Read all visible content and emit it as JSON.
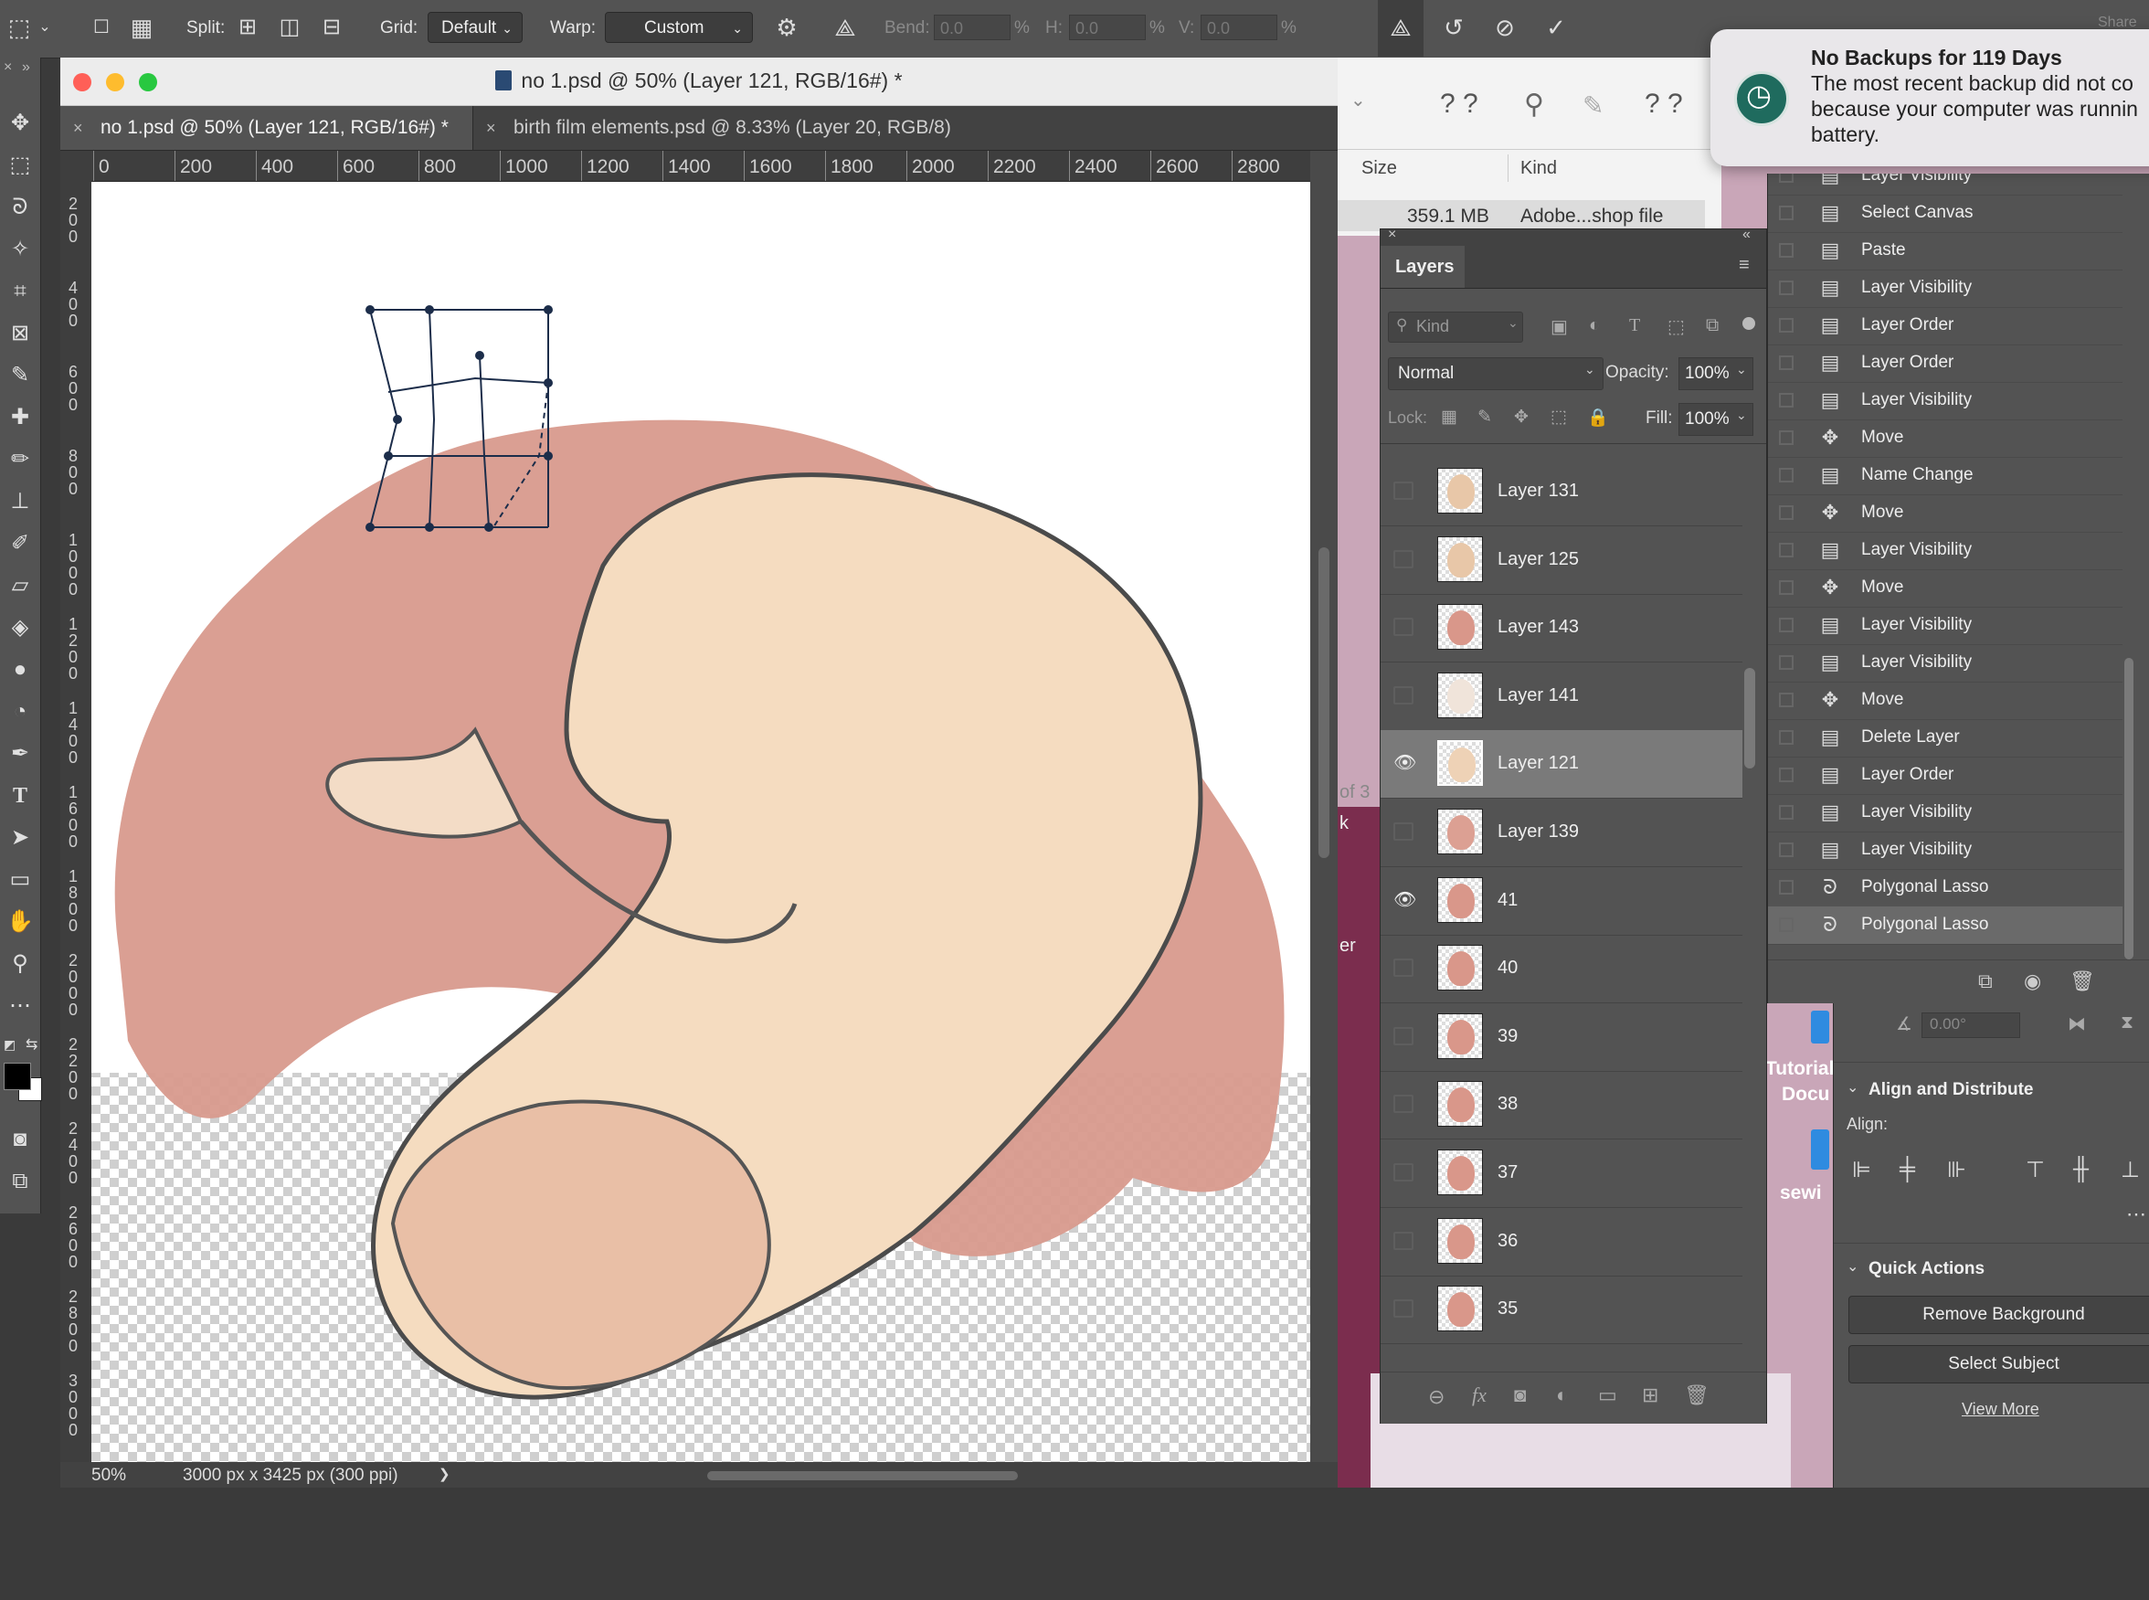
{
  "options_bar": {
    "split_label": "Split:",
    "grid_label": "Grid:",
    "grid_value": "Default",
    "warp_label": "Warp:",
    "warp_value": "Custom",
    "bend_label": "Bend:",
    "bend_value": "0.0",
    "h_label": "H:",
    "h_value": "0.0",
    "v_label": "V:",
    "v_value": "0.0",
    "percent": "%",
    "share_label": "Share"
  },
  "document": {
    "window_title": "no 1.psd @ 50% (Layer 121, RGB/16#) *",
    "tabs": [
      {
        "label": "no 1.psd @ 50% (Layer 121, RGB/16#) *",
        "active": true
      },
      {
        "label": "birth film elements.psd @ 8.33% (Layer 20, RGB/8)",
        "active": false
      }
    ],
    "ruler_h": [
      "0",
      "200",
      "400",
      "600",
      "800",
      "1000",
      "1200",
      "1400",
      "1600",
      "1800",
      "2000",
      "2200",
      "2400",
      "2600",
      "2800"
    ],
    "ruler_v": [
      "200",
      "400",
      "600",
      "800",
      "1000",
      "1200",
      "1400",
      "1600",
      "1800",
      "2000",
      "2200",
      "2400",
      "2600",
      "2800",
      "3000"
    ],
    "zoom": "50%",
    "doc_info": "3000 px x 3425 px (300 ppi)",
    "status_arrow": "❯"
  },
  "finder": {
    "col_size": "Size",
    "col_kind": "Kind",
    "file_size": "359.1 MB",
    "file_kind": "Adobe...shop file",
    "partial_of": "of 3",
    "partial_k": "k",
    "partial_er": "er",
    "partial_tutorial": "Tutorial",
    "partial_docu": "Docu",
    "partial_sewi": "sewi"
  },
  "layers_panel": {
    "tab_label": "Layers",
    "filter_placeholder": "Kind",
    "blend_mode": "Normal",
    "opacity_label": "Opacity:",
    "opacity_value": "100%",
    "lock_label": "Lock:",
    "fill_label": "Fill:",
    "fill_value": "100%",
    "layers": [
      {
        "name": "Layer 131",
        "visible": false,
        "selected": false
      },
      {
        "name": "Layer 125",
        "visible": false,
        "selected": false
      },
      {
        "name": "Layer 143",
        "visible": false,
        "selected": false
      },
      {
        "name": "Layer 141",
        "visible": false,
        "selected": false
      },
      {
        "name": "Layer 121",
        "visible": true,
        "selected": true
      },
      {
        "name": "Layer 139",
        "visible": false,
        "selected": false
      },
      {
        "name": "41",
        "visible": true,
        "selected": false
      },
      {
        "name": "40",
        "visible": false,
        "selected": false
      },
      {
        "name": "39",
        "visible": false,
        "selected": false
      },
      {
        "name": "38",
        "visible": false,
        "selected": false
      },
      {
        "name": "37",
        "visible": false,
        "selected": false
      },
      {
        "name": "36",
        "visible": false,
        "selected": false
      },
      {
        "name": "35",
        "visible": false,
        "selected": false
      }
    ]
  },
  "history_panel": {
    "items": [
      {
        "name": "Layer Visibility",
        "icon": "doc"
      },
      {
        "name": "Select Canvas",
        "icon": "doc"
      },
      {
        "name": "Paste",
        "icon": "doc"
      },
      {
        "name": "Layer Visibility",
        "icon": "doc"
      },
      {
        "name": "Layer Order",
        "icon": "doc"
      },
      {
        "name": "Layer Order",
        "icon": "doc"
      },
      {
        "name": "Layer Visibility",
        "icon": "doc"
      },
      {
        "name": "Move",
        "icon": "move"
      },
      {
        "name": "Name Change",
        "icon": "doc"
      },
      {
        "name": "Move",
        "icon": "move"
      },
      {
        "name": "Layer Visibility",
        "icon": "doc"
      },
      {
        "name": "Move",
        "icon": "move"
      },
      {
        "name": "Layer Visibility",
        "icon": "doc"
      },
      {
        "name": "Layer Visibility",
        "icon": "doc"
      },
      {
        "name": "Move",
        "icon": "move"
      },
      {
        "name": "Delete Layer",
        "icon": "doc"
      },
      {
        "name": "Layer Order",
        "icon": "doc"
      },
      {
        "name": "Layer Visibility",
        "icon": "doc"
      },
      {
        "name": "Layer Visibility",
        "icon": "doc"
      },
      {
        "name": "Polygonal Lasso",
        "icon": "lasso"
      },
      {
        "name": "Polygonal Lasso",
        "icon": "lasso"
      }
    ]
  },
  "properties_panel": {
    "angle_value": "0.00°",
    "align_section": "Align and Distribute",
    "align_label": "Align:",
    "quick_actions_section": "Quick Actions",
    "remove_bg_button": "Remove Background",
    "select_subject_button": "Select Subject",
    "view_more_link": "View More"
  },
  "notification": {
    "title": "No Backups for 119 Days",
    "body_line1": "The most recent backup did not co",
    "body_line2": "because your computer was runnin",
    "body_line3": "battery."
  },
  "colors": {
    "panel_bg": "#535353",
    "selected_row": "#7a7a7a",
    "canvas_pink": "#d89a8d",
    "skin": "#f5dcc0",
    "warp_point": "#1c2d4a"
  }
}
